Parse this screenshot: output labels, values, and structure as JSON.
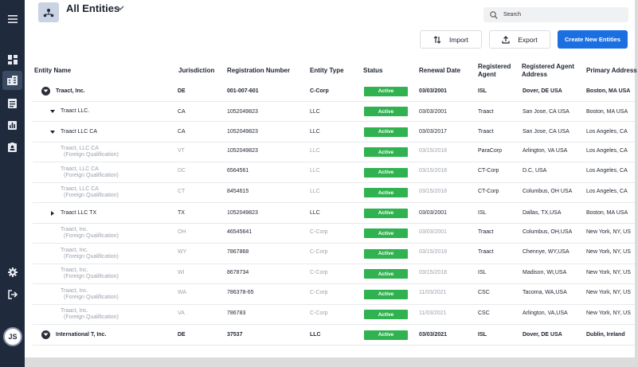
{
  "header": {
    "title": "All Entities"
  },
  "search": {
    "placeholder": "Search"
  },
  "toolbar": {
    "import_label": "Import",
    "export_label": "Export",
    "create_label": "Create New Entities"
  },
  "user": {
    "initials": "JS"
  },
  "colors": {
    "sidebar": "#1f2a3d",
    "primary": "#1b6fe0",
    "status_active": "#2fb24f"
  },
  "sidebar": {
    "items": [
      {
        "icon": "menu-icon"
      },
      {
        "icon": "dashboard-icon"
      },
      {
        "icon": "entities-icon",
        "active": true
      },
      {
        "icon": "document-icon"
      },
      {
        "icon": "chart-icon"
      },
      {
        "icon": "contact-card-icon"
      },
      {
        "icon": "settings-icon"
      },
      {
        "icon": "logout-icon"
      }
    ]
  },
  "table": {
    "columns": [
      "Entity Name",
      "Jurisdiction",
      "Registration Number",
      "Entity Type",
      "Status",
      "Renewal Date",
      "Registered Agent",
      "Registered Agent Address",
      "Primary Address"
    ],
    "rows": [
      {
        "name": "Traact, Inc.",
        "sub": "",
        "jurisdiction": "DE",
        "reg": "001-007-601",
        "type": "C-Corp",
        "status": "Active",
        "renewal": "03/03/2001",
        "agent": "ISL",
        "agent_addr": "Dover, DE USA",
        "primary": "Boston, MA USA"
      },
      {
        "name": "Traact LLC.",
        "sub": "",
        "jurisdiction": "CA",
        "reg": "1052049823",
        "type": "LLC",
        "status": "Active",
        "renewal": "03/03/2001",
        "agent": "Traact",
        "agent_addr": "San Jose, CA USA",
        "primary": "Boston, MA USA"
      },
      {
        "name": "Traact LLC CA",
        "sub": "",
        "jurisdiction": "CA",
        "reg": "1052049823",
        "type": "LLC",
        "status": "Active",
        "renewal": "03/03/2017",
        "agent": "Traact",
        "agent_addr": "San Jose, CA USA",
        "primary": "Los Angeles, CA"
      },
      {
        "name": "Traact, LLC CA",
        "sub": "(Foreign Qualification)",
        "jurisdiction": "VT",
        "reg": "1052049823",
        "type": "LLC",
        "status": "Active",
        "renewal": "03/15/2018",
        "agent": "ParaCorp",
        "agent_addr": "Arlington, VA USA",
        "primary": "Los Angeles, CA"
      },
      {
        "name": "Traact, LLC CA",
        "sub": "(Foreign Qualification)",
        "jurisdiction": "DC",
        "reg": "6564561",
        "type": "LLC",
        "status": "Active",
        "renewal": "03/15/2018",
        "agent": "CT-Corp",
        "agent_addr": "D.C, USA",
        "primary": "Los Angeles, CA"
      },
      {
        "name": "Traact, LLC CA",
        "sub": "(Foreign Qualification)",
        "jurisdiction": "CT",
        "reg": "8454615",
        "type": "LLC",
        "status": "Active",
        "renewal": "03/15/2018",
        "agent": "CT-Corp",
        "agent_addr": "Columbus, OH USA",
        "primary": "Los Angeles, CA"
      },
      {
        "name": "Traact LLC TX",
        "sub": "",
        "jurisdiction": "TX",
        "reg": "1052049823",
        "type": "LLC",
        "status": "Active",
        "renewal": "03/03/2001",
        "agent": "ISL",
        "agent_addr": "Dallas, TX,USA",
        "primary": "Boston, MA USA"
      },
      {
        "name": "Traact, Inc.",
        "sub": "(Foreign Qualification)",
        "jurisdiction": "OH",
        "reg": "46545641",
        "type": "C-Corp",
        "status": "Active",
        "renewal": "03/03/2001",
        "agent": "Traact",
        "agent_addr": "Columbus, OH,USA",
        "primary": "New York, NY, US"
      },
      {
        "name": "Traact, Inc.",
        "sub": "(Foreign Qualification)",
        "jurisdiction": "WY",
        "reg": "7867868",
        "type": "C-Corp",
        "status": "Active",
        "renewal": "03/15/2018",
        "agent": "Traact",
        "agent_addr": "Chennye, WY,USA",
        "primary": "New York, NY, US"
      },
      {
        "name": "Traact, Inc.",
        "sub": "(Foreign Qualification)",
        "jurisdiction": "WI",
        "reg": "8678734",
        "type": "C-Corp",
        "status": "Active",
        "renewal": "03/15/2018",
        "agent": "ISL",
        "agent_addr": "Madison, WI,USA",
        "primary": "New York, NY, US"
      },
      {
        "name": "Traact, Inc.",
        "sub": "(Foreign Qualification)",
        "jurisdiction": "WA",
        "reg": "786378-65",
        "type": "C-Corp",
        "status": "Active",
        "renewal": "11/03/2021",
        "agent": "CSC",
        "agent_addr": "Tacoma, WA,USA",
        "primary": "New York, NY, US"
      },
      {
        "name": "Traact, Inc.",
        "sub": "(Foreign Qualification)",
        "jurisdiction": "VA",
        "reg": "786783",
        "type": "C-Corp",
        "status": "Active",
        "renewal": "11/03/2021",
        "agent": "CSC",
        "agent_addr": "Arlington, VA,USA",
        "primary": "New York, NY, US"
      },
      {
        "name": "International T, Inc.",
        "sub": "",
        "jurisdiction": "DE",
        "reg": "37537",
        "type": "LLC",
        "status": "Active",
        "renewal": "03/03/2021",
        "agent": "ISL",
        "agent_addr": "Dover, DE USA",
        "primary": "Dublin, Ireland"
      }
    ]
  }
}
